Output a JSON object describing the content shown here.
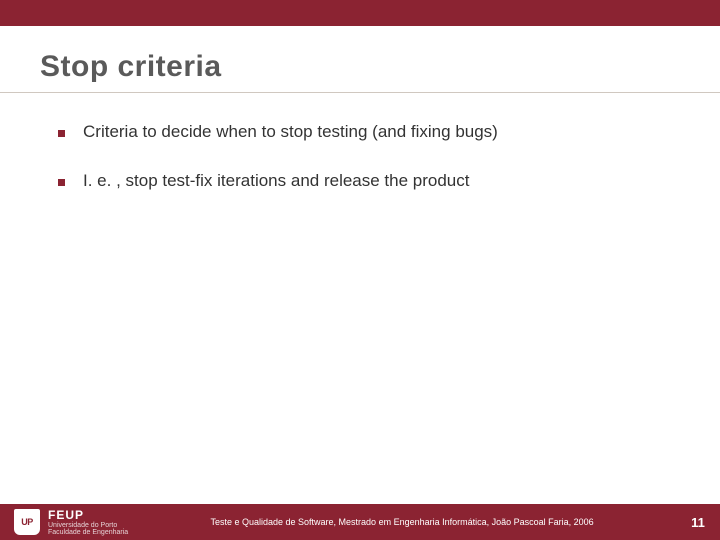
{
  "title": "Stop criteria",
  "bullets": [
    "Criteria to decide when to stop testing (and fixing bugs)",
    "I. e. , stop test-fix iterations and release the product"
  ],
  "footer": {
    "logo_label": "FEUP",
    "logo_sub1": "Universidade do Porto",
    "logo_sub2": "Faculdade de Engenharia",
    "center_text": "Teste e Qualidade de Software, Mestrado em Engenharia Informática, João Pascoal Faria, 2006",
    "page_number": "11"
  }
}
